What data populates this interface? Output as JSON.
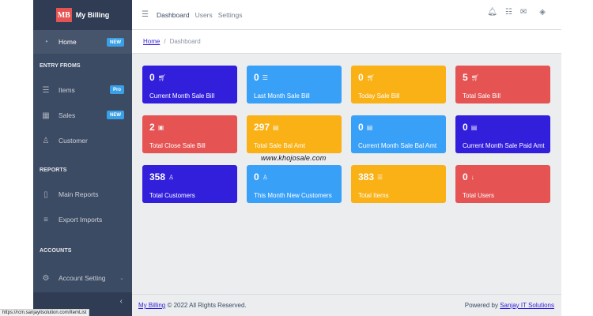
{
  "brand": {
    "logo": "MB",
    "name": "My Billing"
  },
  "sidebar": {
    "home": {
      "label": "Home",
      "badge": "NEW"
    },
    "section_entry": "ENTRY FROMS",
    "items": {
      "label": "Items",
      "badge": "Pro"
    },
    "sales": {
      "label": "Sales",
      "badge": "NEW"
    },
    "customer": {
      "label": "Customer"
    },
    "section_reports": "REPORTS",
    "main_reports": {
      "label": "Main Reports"
    },
    "export_imports": {
      "label": "Export Imports"
    },
    "section_accounts": "ACCOUNTS",
    "account_setting": {
      "label": "Account Setting"
    }
  },
  "header": {
    "nav": [
      "Dashboard",
      "Users",
      "Settings"
    ]
  },
  "breadcrumb": {
    "home": "Home",
    "separator": "/",
    "current": "Dashboard"
  },
  "cards": [
    {
      "value": "0",
      "label": "Current Month Sale Bill",
      "color": "#321fdb",
      "icon": "cart-icon"
    },
    {
      "value": "0",
      "label": "Last Month Sale Bill",
      "color": "#39a0f8",
      "icon": "list-icon"
    },
    {
      "value": "0",
      "label": "Today Sale Bill",
      "color": "#f9b115",
      "icon": "cart-icon"
    },
    {
      "value": "5",
      "label": "Total Sale Bill",
      "color": "#e55353",
      "icon": "cart-icon"
    },
    {
      "value": "2",
      "label": "Total Close Sale Bill",
      "color": "#e55353",
      "icon": "inbox-icon"
    },
    {
      "value": "297",
      "label": "Total Sale Bal Amt",
      "color": "#f9b115",
      "icon": "money-icon"
    },
    {
      "value": "0",
      "label": "Current Month Sale Bal Amt",
      "color": "#39a0f8",
      "icon": "money-icon"
    },
    {
      "value": "0",
      "label": "Current Month Sale Paid Amt",
      "color": "#321fdb",
      "icon": "money-icon"
    },
    {
      "value": "358",
      "label": "Total Customers",
      "color": "#321fdb",
      "icon": "user-icon"
    },
    {
      "value": "0",
      "label": "This Month New Customers",
      "color": "#39a0f8",
      "icon": "user-icon"
    },
    {
      "value": "383",
      "label": "Total Items",
      "color": "#f9b115",
      "icon": "list-icon"
    },
    {
      "value": "0",
      "label": "Total Users",
      "color": "#e55353",
      "icon": "arrow-down-icon"
    }
  ],
  "watermark": "www.khojosale.com",
  "footer": {
    "brand_link": "My Billing",
    "copyright": "© 2022 All Rights Reserved.",
    "powered": "Powered by",
    "company_link": "Sanjay IT Solutions"
  },
  "status_url": "https://rcm.sanjayitsolution.com/ItemList"
}
